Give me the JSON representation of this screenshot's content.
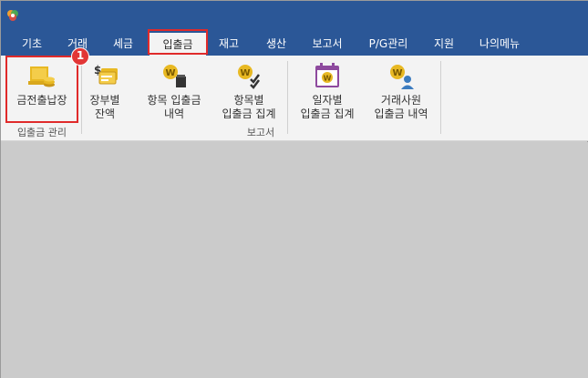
{
  "tabs": [
    {
      "label": "기초"
    },
    {
      "label": "거래"
    },
    {
      "label": "세금"
    },
    {
      "label": "입출금"
    },
    {
      "label": "재고"
    },
    {
      "label": "생산"
    },
    {
      "label": "보고서"
    },
    {
      "label": "P/G관리"
    },
    {
      "label": "지원"
    },
    {
      "label": "나의메뉴"
    }
  ],
  "active_tab": "입출금",
  "ribbon": {
    "buttons": [
      {
        "label": "금전출납장",
        "icon": "cash-ledger-icon"
      },
      {
        "label": "장부별\n잔액",
        "icon": "ledger-balance-icon"
      },
      {
        "label": "항목 입출금\n내역",
        "icon": "item-history-icon"
      },
      {
        "label": "항목별\n입출금 집계",
        "icon": "item-summary-icon"
      },
      {
        "label": "일자별\n입출금 집계",
        "icon": "calendar-summary-icon"
      },
      {
        "label": "거래사원\n입출금 내역",
        "icon": "staff-history-icon"
      }
    ],
    "groups": [
      {
        "label": "입출금 관리"
      },
      {
        "label": "보고서"
      }
    ]
  },
  "badge": "1",
  "colors": {
    "titlebar": "#2b5797",
    "highlight": "#e02a2a",
    "coin": "#e8b923",
    "calendar": "#8e4a9e"
  }
}
